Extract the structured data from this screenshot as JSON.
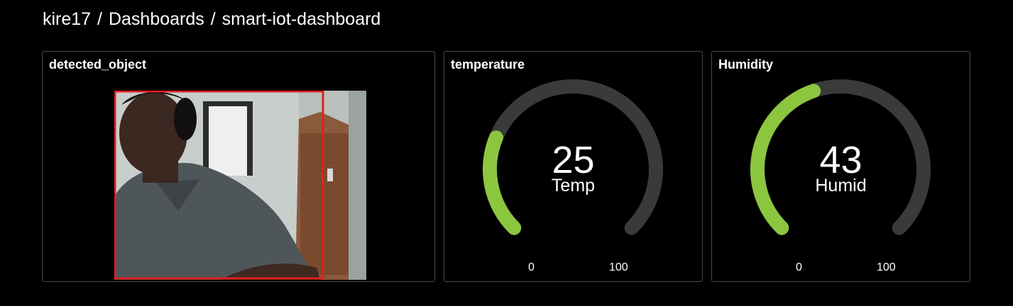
{
  "breadcrumb": {
    "user": "kire17",
    "separator": "/",
    "section": "Dashboards",
    "dashboard": "smart-iot-dashboard"
  },
  "panels": {
    "detected_object": {
      "title": "detected_object"
    },
    "temperature": {
      "title": "temperature",
      "value": "25",
      "unit_label": "Temp",
      "min": "0",
      "max": "100",
      "fraction": 0.25
    },
    "humidity": {
      "title": "Humidity",
      "value": "43",
      "unit_label": "Humid",
      "min": "0",
      "max": "100",
      "fraction": 0.43
    }
  },
  "colors": {
    "gauge_fill": "#8cc63f",
    "gauge_track": "#3a3a3a",
    "bounding_box": "#e0201e"
  }
}
